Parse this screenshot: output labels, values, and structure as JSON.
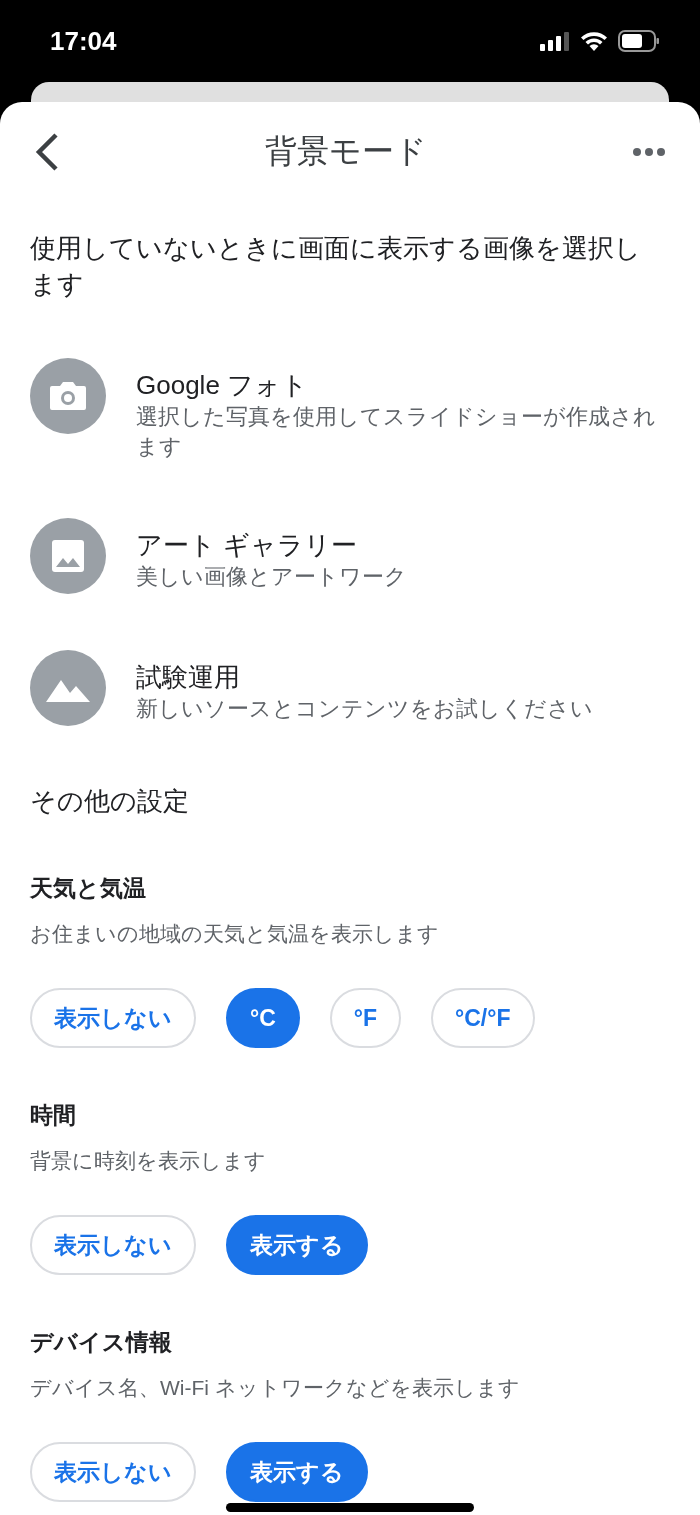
{
  "status_bar": {
    "time": "17:04"
  },
  "header": {
    "title": "背景モード"
  },
  "intro": "使用していないときに画面に表示する画像を選択します",
  "sources": [
    {
      "kind": "camera",
      "title": "Google フォト",
      "subtitle": "選択した写真を使用してスライドショーが作成されます"
    },
    {
      "kind": "image",
      "title": "アート ギャラリー",
      "subtitle": "美しい画像とアートワーク"
    },
    {
      "kind": "mountain",
      "title": "試験運用",
      "subtitle": "新しいソースとコンテンツをお試しください"
    }
  ],
  "other_settings": {
    "heading": "その他の設定",
    "sections": [
      {
        "title": "天気と気温",
        "description": "お住まいの地域の天気と気温を表示します",
        "options": [
          {
            "label": "表示しない",
            "selected": false
          },
          {
            "label": "°C",
            "selected": true
          },
          {
            "label": "°F",
            "selected": false
          },
          {
            "label": "°C/°F",
            "selected": false
          }
        ]
      },
      {
        "title": "時間",
        "description": "背景に時刻を表示します",
        "options": [
          {
            "label": "表示しない",
            "selected": false
          },
          {
            "label": "表示する",
            "selected": true
          }
        ]
      },
      {
        "title": "デバイス情報",
        "description": "デバイス名、Wi-Fi ネットワークなどを表示します",
        "options": [
          {
            "label": "表示しない",
            "selected": false
          },
          {
            "label": "表示する",
            "selected": true
          }
        ]
      }
    ]
  }
}
